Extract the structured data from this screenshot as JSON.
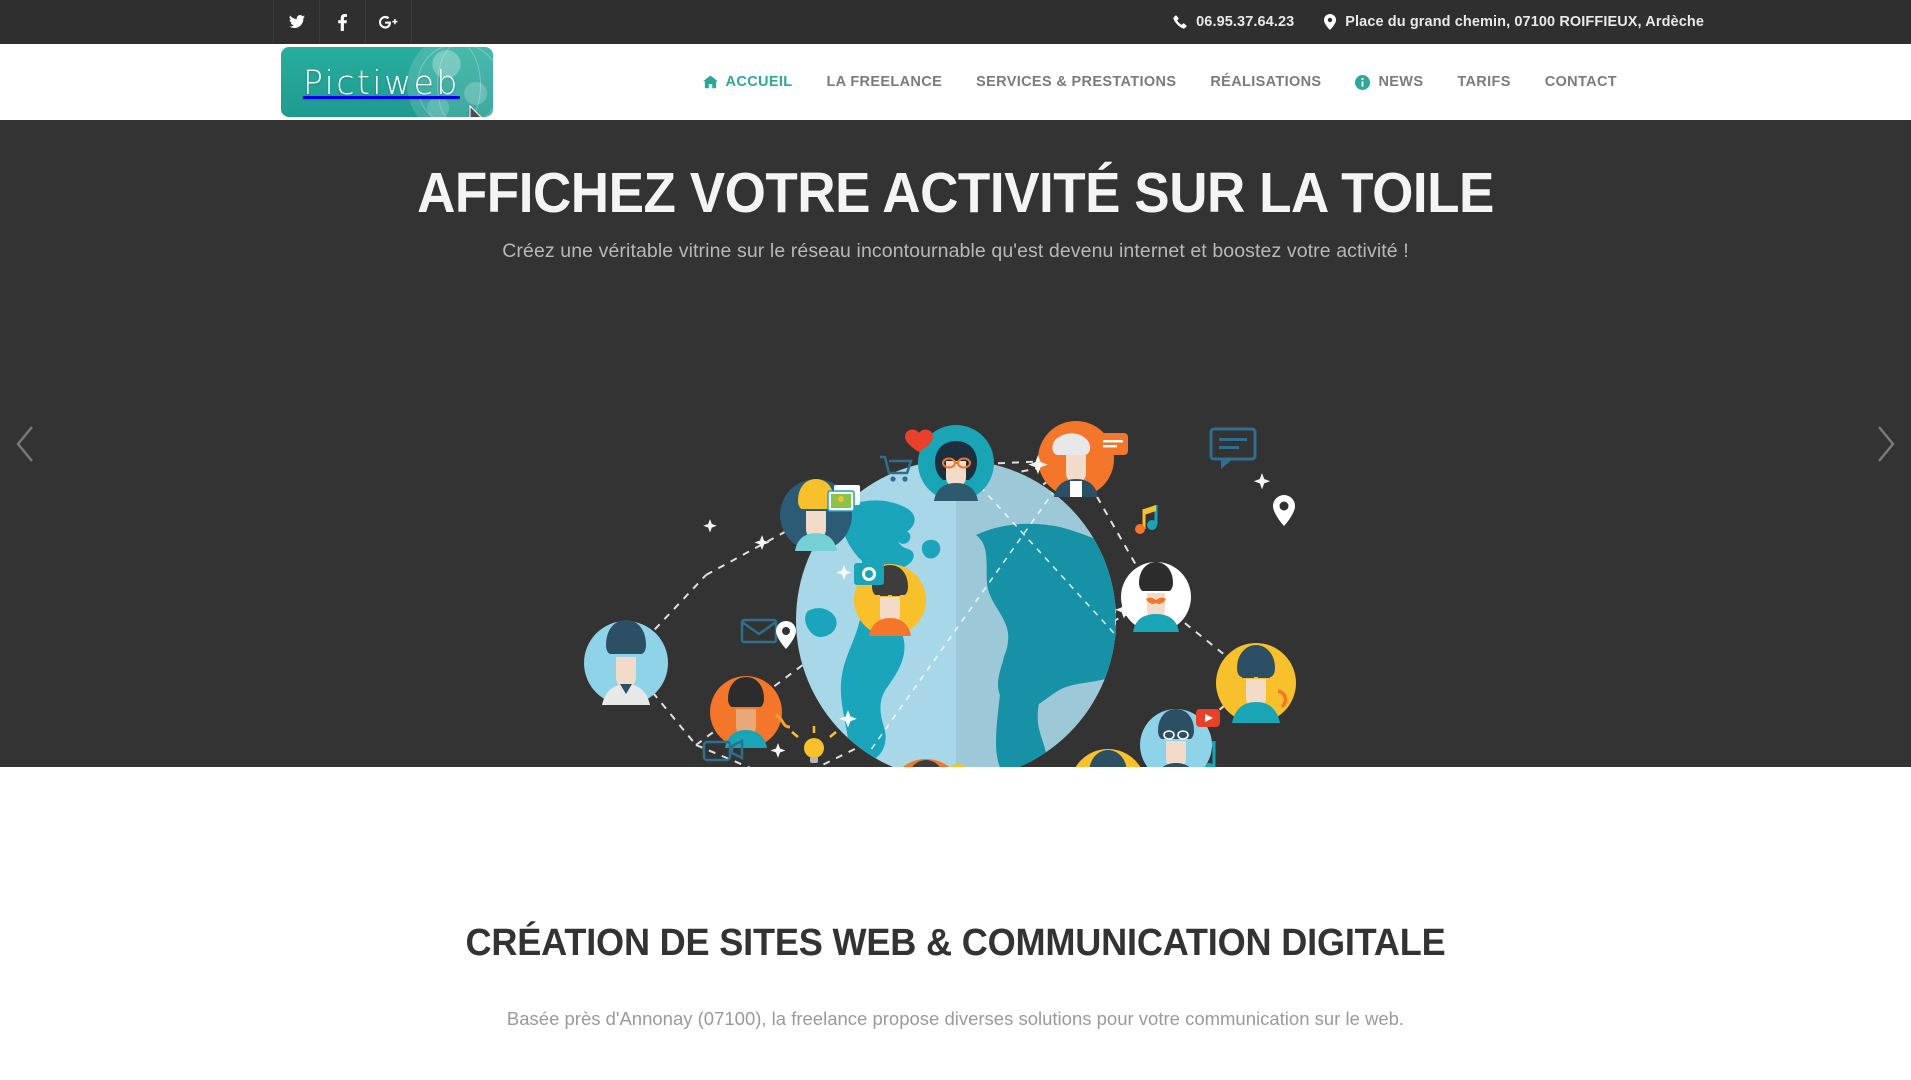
{
  "topbar": {
    "social": [
      {
        "name": "twitter",
        "label": "Twitter",
        "icon": "twitter-icon"
      },
      {
        "name": "facebook",
        "label": "Facebook",
        "icon": "facebook-icon"
      },
      {
        "name": "googleplus",
        "label": "Google Plus",
        "icon": "google-plus-icon"
      }
    ],
    "phone": "06.95.37.64.23",
    "address": "Place du grand chemin, 07100 ROIFFIEUX, Ardèche"
  },
  "header": {
    "logo_text": "Pictiweb",
    "nav": [
      {
        "label": "ACCUEIL",
        "active": true,
        "icon": "home-icon"
      },
      {
        "label": "LA FREELANCE",
        "active": false,
        "icon": ""
      },
      {
        "label": "SERVICES & PRESTATIONS",
        "active": false,
        "icon": ""
      },
      {
        "label": "RÉALISATIONS",
        "active": false,
        "icon": ""
      },
      {
        "label": "NEWS",
        "active": false,
        "icon": "info-icon"
      },
      {
        "label": "TARIFS",
        "active": false,
        "icon": ""
      },
      {
        "label": "CONTACT",
        "active": false,
        "icon": ""
      }
    ]
  },
  "hero": {
    "title": "AFFICHEZ VOTRE ACTIVITÉ SUR LA TOILE",
    "subtitle": "Créez une véritable vitrine sur le réseau incontournable qu'est devenu internet et boostez votre activité !",
    "prev_label": "Précédent",
    "next_label": "Suivant"
  },
  "intro": {
    "title": "CRÉATION DE SITES WEB & COMMUNICATION DIGITALE",
    "subtitle": "Basée près d'Annonay (07100), la freelance propose diverses solutions pour votre communication sur le web."
  },
  "colors": {
    "accent": "#2aa89a",
    "dark": "#333333",
    "topbar": "#2f2f2f",
    "nav_text": "#7b7b7b",
    "globe_land": "#1ba5bd",
    "globe_ocean": "#a8d8e8",
    "orange": "#f4762a",
    "yellow": "#f8c12c"
  }
}
